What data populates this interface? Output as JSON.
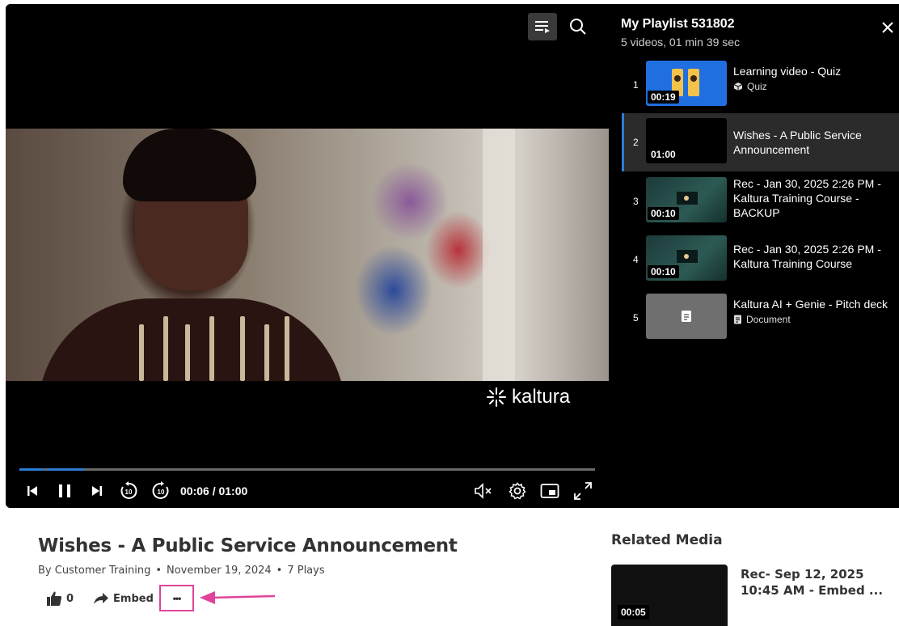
{
  "player": {
    "current_time": "00:06 / 01:00",
    "progress_fraction": 0.1,
    "logo_text": "kaltura"
  },
  "playlist": {
    "title": "My Playlist 531802",
    "subtitle": "5 videos, 01 min 39 sec",
    "items": [
      {
        "num": "1",
        "duration": "00:19",
        "title": "Learning video - Quiz",
        "meta": "Quiz",
        "meta_icon": "cube-icon",
        "active": false
      },
      {
        "num": "2",
        "duration": "01:00",
        "title": "Wishes - A Public Service Announcement",
        "meta": "",
        "active": true
      },
      {
        "num": "3",
        "duration": "00:10",
        "title": "Rec - Jan 30, 2025 2:26 PM - Kaltura Training Course - BACKUP",
        "meta": "",
        "active": false
      },
      {
        "num": "4",
        "duration": "00:10",
        "title": "Rec - Jan 30, 2025 2:26 PM - Kaltura Training Course",
        "meta": "",
        "active": false
      },
      {
        "num": "5",
        "duration": "",
        "title": "Kaltura AI + Genie - Pitch deck",
        "meta": "Document",
        "meta_icon": "document-icon",
        "active": false
      }
    ]
  },
  "media": {
    "title": "Wishes - A Public Service Announcement",
    "author": "By Customer Training",
    "date": "November 19, 2024",
    "plays": "7 Plays",
    "likes": "0",
    "embed_label": "Embed",
    "more_label": "•••"
  },
  "related": {
    "title": "Related Media",
    "items": [
      {
        "duration": "00:05",
        "title": "Rec- Sep 12, 2025 10:45 AM - Embed ..."
      }
    ]
  },
  "colors": {
    "accent": "#2f7cd6",
    "highlight": "#e0449a"
  }
}
